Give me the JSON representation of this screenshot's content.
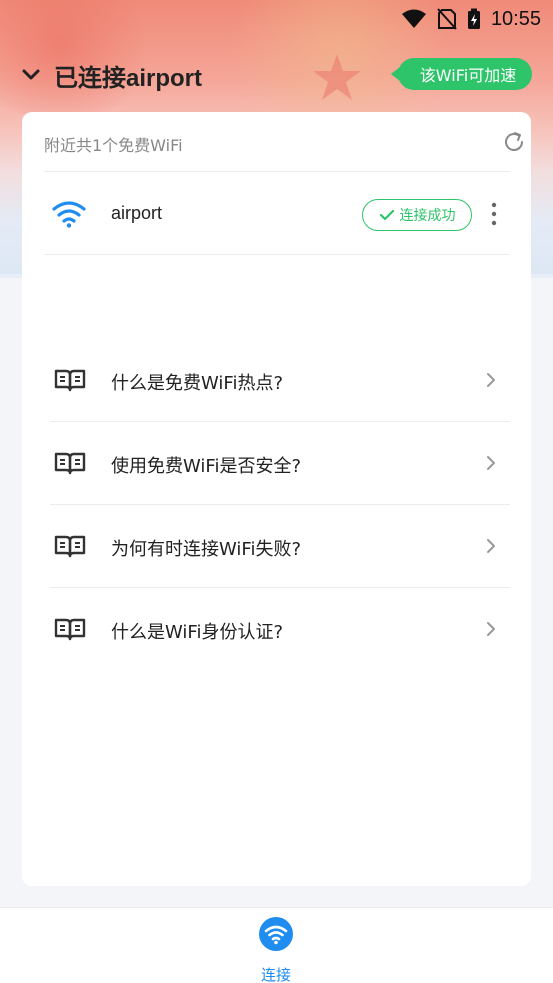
{
  "status_bar": {
    "time": "10:55",
    "icons": [
      "wifi-signal-icon",
      "no-sim-icon",
      "battery-charging-icon"
    ]
  },
  "header": {
    "title": "已连接airport",
    "back_icon": "chevron-down-icon",
    "speed_button": "该WiFi可加速"
  },
  "card": {
    "nearby_count": "附近共1个免费WiFi",
    "refresh_icon": "refresh-icon",
    "networks": [
      {
        "ssid": "airport",
        "status": "连接成功",
        "icon": "wifi-icon"
      }
    ]
  },
  "faq": [
    {
      "question": "什么是免费WiFi热点?"
    },
    {
      "question": "使用免费WiFi是否安全?"
    },
    {
      "question": "为何有时连接WiFi失败?"
    },
    {
      "question": "什么是WiFi身份认证?"
    }
  ],
  "tabbar": {
    "connect_label": "连接"
  },
  "colors": {
    "accent_green": "#2ec46a",
    "accent_blue": "#1f8cf0"
  }
}
